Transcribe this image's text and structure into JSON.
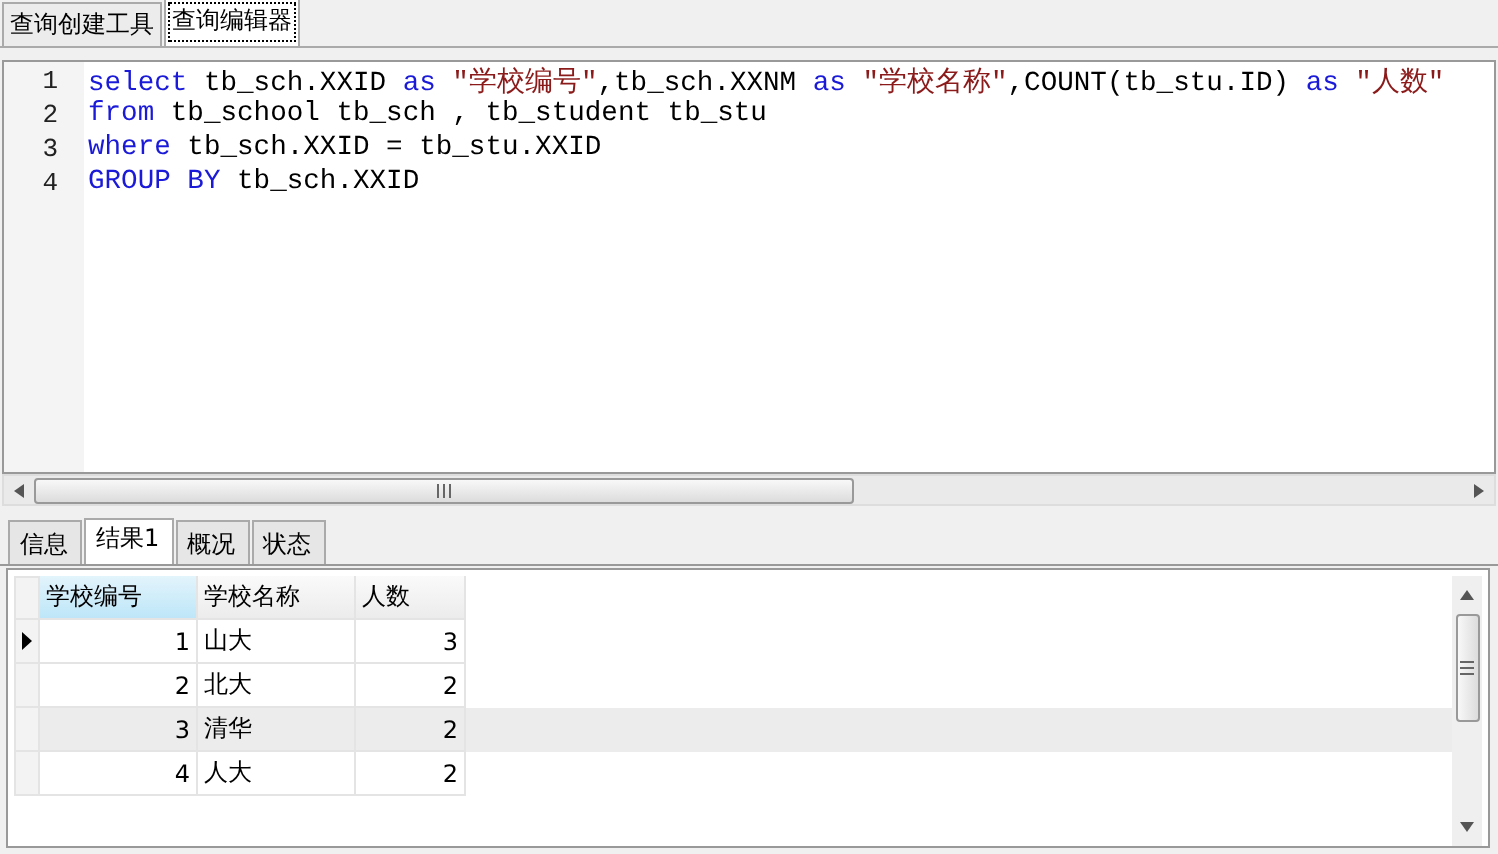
{
  "top_tabs": [
    {
      "label": "查询创建工具",
      "selected": false
    },
    {
      "label": "查询编辑器",
      "selected": true
    }
  ],
  "editor": {
    "lines": [
      {
        "number": "1",
        "tokens": [
          {
            "kind": "keyword",
            "text": "select"
          },
          {
            "kind": "plain",
            "text": " tb_sch.XXID "
          },
          {
            "kind": "keyword",
            "text": "as"
          },
          {
            "kind": "string",
            "text": " \"学校编号\""
          },
          {
            "kind": "plain",
            "text": ",tb_sch.XXNM "
          },
          {
            "kind": "keyword",
            "text": "as"
          },
          {
            "kind": "string",
            "text": " \"学校名称\""
          },
          {
            "kind": "plain",
            "text": ",COUNT(tb_stu.ID) "
          },
          {
            "kind": "keyword",
            "text": "as"
          },
          {
            "kind": "string",
            "text": " \"人数\""
          }
        ]
      },
      {
        "number": "2",
        "tokens": [
          {
            "kind": "keyword",
            "text": "from"
          },
          {
            "kind": "plain",
            "text": " tb_school tb_sch , tb_student tb_stu"
          }
        ]
      },
      {
        "number": "3",
        "tokens": [
          {
            "kind": "keyword",
            "text": "where"
          },
          {
            "kind": "plain",
            "text": " tb_sch.XXID = tb_stu.XXID"
          }
        ]
      },
      {
        "number": "4",
        "tokens": [
          {
            "kind": "keyword",
            "text": "GROUP BY"
          },
          {
            "kind": "plain",
            "text": " tb_sch.XXID"
          }
        ]
      }
    ]
  },
  "result_tabs": [
    {
      "label": "信息",
      "selected": false
    },
    {
      "label": "结果1",
      "selected": true
    },
    {
      "label": "概况",
      "selected": false
    },
    {
      "label": "状态",
      "selected": false
    }
  ],
  "grid": {
    "columns": [
      {
        "label": "学校编号",
        "selected": true
      },
      {
        "label": "学校名称",
        "selected": false
      },
      {
        "label": "人数",
        "selected": false
      }
    ],
    "rows": [
      {
        "current": true,
        "highlighted": false,
        "cells": [
          "1",
          "山大",
          "3"
        ]
      },
      {
        "current": false,
        "highlighted": false,
        "cells": [
          "2",
          "北大",
          "2"
        ]
      },
      {
        "current": false,
        "highlighted": true,
        "cells": [
          "3",
          "清华",
          "2"
        ]
      },
      {
        "current": false,
        "highlighted": false,
        "cells": [
          "4",
          "人大",
          "2"
        ]
      }
    ]
  }
}
